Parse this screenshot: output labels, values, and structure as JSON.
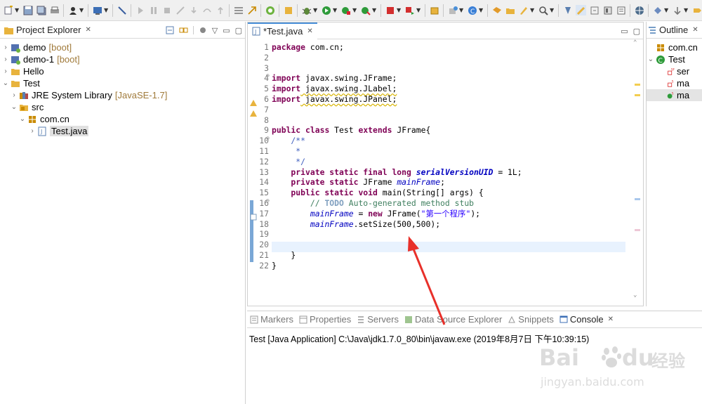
{
  "explorer": {
    "tab_label": "Project Explorer",
    "tree": [
      {
        "label": "demo",
        "tag": "[boot]",
        "icon": "boot-project-icon"
      },
      {
        "label": "demo-1",
        "tag": "[boot]",
        "icon": "boot-project-icon"
      },
      {
        "label": "Hello",
        "tag": "",
        "icon": "folder-project-icon"
      },
      {
        "label": "Test",
        "tag": "",
        "icon": "folder-project-icon"
      },
      {
        "label": "JRE System Library",
        "tag": "[JavaSE-1.7]",
        "icon": "library-icon"
      },
      {
        "label": "src",
        "tag": "",
        "icon": "source-folder-icon"
      },
      {
        "label": "com.cn",
        "tag": "",
        "icon": "package-icon"
      },
      {
        "label": "Test.java",
        "tag": "",
        "icon": "java-file-icon"
      }
    ]
  },
  "editor": {
    "tab_label": "*Test.java",
    "line_numbers": [
      "1",
      "2",
      "3",
      "4",
      "5",
      "6",
      "7",
      "8",
      "9",
      "10",
      "11",
      "12",
      "13",
      "14",
      "15",
      "16",
      "17",
      "18",
      "19",
      "20",
      "21",
      "22"
    ],
    "code": {
      "l1_kw": "package",
      "l1_rest": " com.cn;",
      "l4_kw": "import",
      "l4_rest": " javax.swing.JFrame;",
      "l5_kw": "import",
      "l5_rest": " javax.swing.JLabel;",
      "l6_kw": "import",
      "l6_rest": " javax.swing.JPanel;",
      "l9_kw1": "public",
      "l9_kw2": "class",
      "l9_name": " Test ",
      "l9_kw3": "extends",
      "l9_rest": " JFrame{",
      "l10": "    /**",
      "l11": "     *",
      "l12": "     */",
      "l13_kw": "    private static final long",
      "l13_fld": "serialVersionUID",
      "l13_rest": " = 1L;",
      "l14_kw": "    private static",
      "l14_type": " JFrame ",
      "l14_fld": "mainFrame",
      "l14_rest": ";",
      "l15_kw": "    public static void",
      "l15_rest": " main(String[] args) {",
      "l16_cm": "        // ",
      "l16_todo": "TODO",
      "l16_rest": " Auto-generated method stub",
      "l17_fld": "mainFrame",
      "l17_mid": " = ",
      "l17_kw": "new",
      "l17_call": " JFrame(",
      "l17_str": "\"第一个程序\"",
      "l17_end": ");",
      "l18_fld": "mainFrame",
      "l18_rest": ".setSize(500,500);",
      "l21": "    }",
      "l22": "}"
    }
  },
  "outline": {
    "tab_label": "Outline",
    "items": [
      "com.cn",
      "Test",
      "ser",
      "ma",
      "ma"
    ]
  },
  "console": {
    "tabs": [
      "Markers",
      "Properties",
      "Servers",
      "Data Source Explorer",
      "Snippets",
      "Console"
    ],
    "output": "Test [Java Application] C:\\Java\\jdk1.7.0_80\\bin\\javaw.exe (2019年8月7日 下午10:39:15)"
  },
  "watermark": {
    "brand": "Bai",
    "brand2": "du",
    "cn": "经验",
    "url": "jingyan.baidu.com"
  },
  "colors": {
    "keyword": "#7f0055",
    "comment": "#3f5fbf",
    "string": "#2a00ff",
    "field": "#0000c0",
    "current_line": "#e8f2fe",
    "annotation_arrow": "#e8302a"
  }
}
